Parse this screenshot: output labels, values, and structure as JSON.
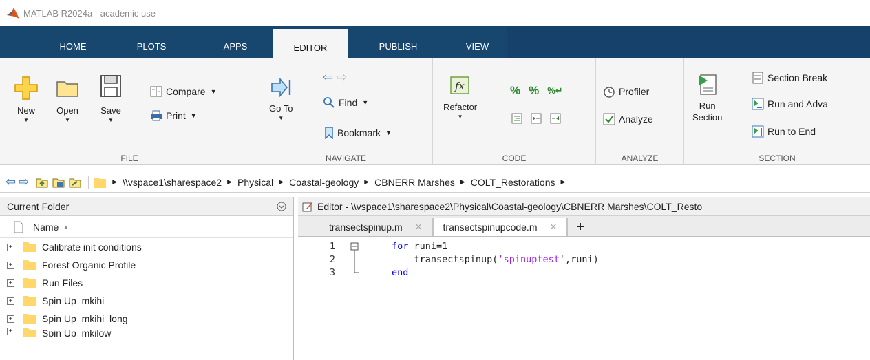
{
  "window": {
    "title": "MATLAB R2024a - academic use"
  },
  "tabs": [
    "HOME",
    "PLOTS",
    "APPS",
    "EDITOR",
    "PUBLISH",
    "VIEW"
  ],
  "active_tab": "EDITOR",
  "ribbon": {
    "file": {
      "label": "FILE",
      "new": "New",
      "open": "Open",
      "save": "Save",
      "compare": "Compare",
      "print": "Print"
    },
    "navigate": {
      "label": "NAVIGATE",
      "goto": "Go To",
      "find": "Find",
      "bookmark": "Bookmark"
    },
    "code": {
      "label": "CODE",
      "refactor": "Refactor"
    },
    "analyze": {
      "label": "ANALYZE",
      "profiler": "Profiler",
      "analyze": "Analyze"
    },
    "section": {
      "label": "SECTION",
      "run_section_1": "Run",
      "run_section_2": "Section",
      "section_break": "Section Break",
      "run_and_advance": "Run and Adva",
      "run_to_end": "Run to End"
    }
  },
  "address": [
    "\\\\vspace1\\sharespace2",
    "Physical",
    "Coastal-geology",
    "CBNERR Marshes",
    "COLT_Restorations"
  ],
  "folder": {
    "title": "Current Folder",
    "column": "Name",
    "items": [
      "Calibrate init conditions",
      "Forest Organic Profile",
      "Run Files",
      "Spin Up_mkihi",
      "Spin Up_mkihi_long",
      "Spin Up_mkilow"
    ]
  },
  "editor": {
    "title": "Editor - \\\\vspace1\\sharespace2\\Physical\\Coastal-geology\\CBNERR Marshes\\COLT_Resto",
    "tabs": [
      "transectspinup.m",
      "transectspinupcode.m"
    ],
    "line_numbers": [
      "1",
      "2",
      "3"
    ],
    "code": {
      "l1_kw": "for",
      "l1_rest": " runi=1",
      "l2_a": "    transectspinup(",
      "l2_str": "'spinuptest'",
      "l2_b": ",runi)",
      "l3_kw": "end"
    }
  },
  "colors": {
    "tabstrip": "#17466f",
    "ribbon": "#f5f5f5",
    "keyword": "#0000ff",
    "string": "#a020f0"
  }
}
